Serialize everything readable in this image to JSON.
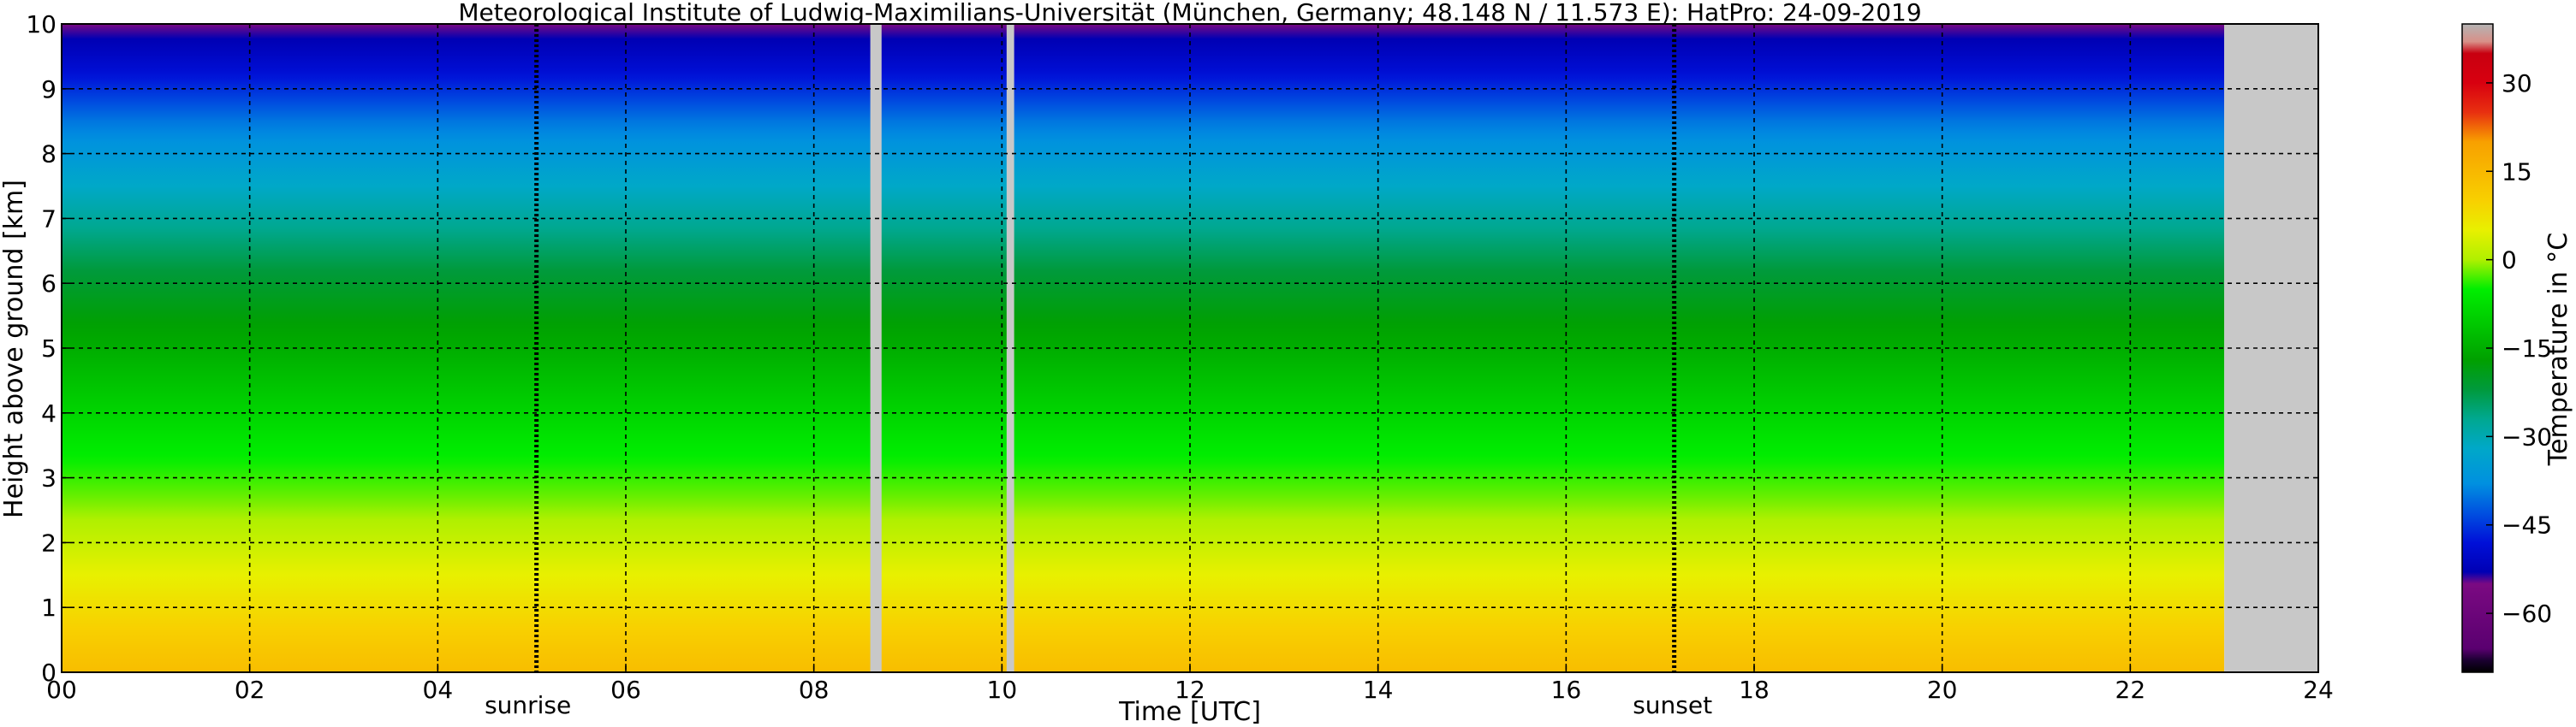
{
  "chart_data": {
    "type": "heatmap",
    "title": "Meteorological Institute of Ludwig-Maximilians-Universität (München, Germany; 48.148 N / 11.573 E):    HatPro: 24-09-2019",
    "xlabel": "Time [UTC]",
    "ylabel": "Height above ground [km]",
    "xlim": [
      0,
      24
    ],
    "ylim": [
      0,
      10
    ],
    "x_ticks": [
      "00",
      "02",
      "04",
      "06",
      "08",
      "10",
      "12",
      "14",
      "16",
      "18",
      "20",
      "22",
      "24"
    ],
    "y_ticks": [
      "0",
      "1",
      "2",
      "3",
      "4",
      "5",
      "6",
      "7",
      "8",
      "9",
      "10"
    ],
    "grid": true,
    "data_end_hour": 23.0,
    "no_data_color": "#c8c8c8",
    "gaps_hours": [
      [
        8.6,
        8.72
      ],
      [
        10.05,
        10.13
      ]
    ],
    "sunrise": {
      "label": "sunrise",
      "hour": 5.05
    },
    "sunset": {
      "label": "sunset",
      "hour": 17.15
    },
    "temperature_profile": [
      {
        "height_km": 0.0,
        "temp_c": 14
      },
      {
        "height_km": 1.0,
        "temp_c": 8
      },
      {
        "height_km": 2.0,
        "temp_c": 2
      },
      {
        "height_km": 2.7,
        "temp_c": -2
      },
      {
        "height_km": 3.5,
        "temp_c": -6
      },
      {
        "height_km": 5.0,
        "temp_c": -15
      },
      {
        "height_km": 6.2,
        "temp_c": -22
      },
      {
        "height_km": 7.5,
        "temp_c": -32
      },
      {
        "height_km": 8.5,
        "temp_c": -40
      },
      {
        "height_km": 9.3,
        "temp_c": -49
      },
      {
        "height_km": 10.0,
        "temp_c": -55
      }
    ],
    "colorbar": {
      "label": "Temperature in °C",
      "ticks": [
        "30",
        "15",
        "0",
        "−15",
        "−30",
        "−45",
        "−60"
      ],
      "tick_values": [
        30,
        15,
        0,
        -15,
        -30,
        -45,
        -60
      ],
      "range": [
        -70,
        40
      ]
    },
    "colormap": [
      {
        "temp_c": -70,
        "color": "#000000"
      },
      {
        "temp_c": -68,
        "color": "#1a0030"
      },
      {
        "temp_c": -66,
        "color": "#5a0070"
      },
      {
        "temp_c": -55,
        "color": "#7b0a82"
      },
      {
        "temp_c": -53,
        "color": "#0000b4"
      },
      {
        "temp_c": -48,
        "color": "#0010d8"
      },
      {
        "temp_c": -43,
        "color": "#0050e0"
      },
      {
        "temp_c": -38,
        "color": "#0090e0"
      },
      {
        "temp_c": -32,
        "color": "#00a8c8"
      },
      {
        "temp_c": -27,
        "color": "#00a890"
      },
      {
        "temp_c": -22,
        "color": "#009a3c"
      },
      {
        "temp_c": -17,
        "color": "#00a000"
      },
      {
        "temp_c": -11,
        "color": "#00c800"
      },
      {
        "temp_c": -5,
        "color": "#00ee00"
      },
      {
        "temp_c": 0,
        "color": "#b0f000"
      },
      {
        "temp_c": 5,
        "color": "#e8f000"
      },
      {
        "temp_c": 10,
        "color": "#f8d000"
      },
      {
        "temp_c": 15,
        "color": "#f8b800"
      },
      {
        "temp_c": 20,
        "color": "#f8a000"
      },
      {
        "temp_c": 25,
        "color": "#e83010"
      },
      {
        "temp_c": 30,
        "color": "#d80010"
      },
      {
        "temp_c": 35,
        "color": "#c80010"
      },
      {
        "temp_c": 37,
        "color": "#d89088"
      },
      {
        "temp_c": 40,
        "color": "#b4b4b4"
      }
    ]
  }
}
